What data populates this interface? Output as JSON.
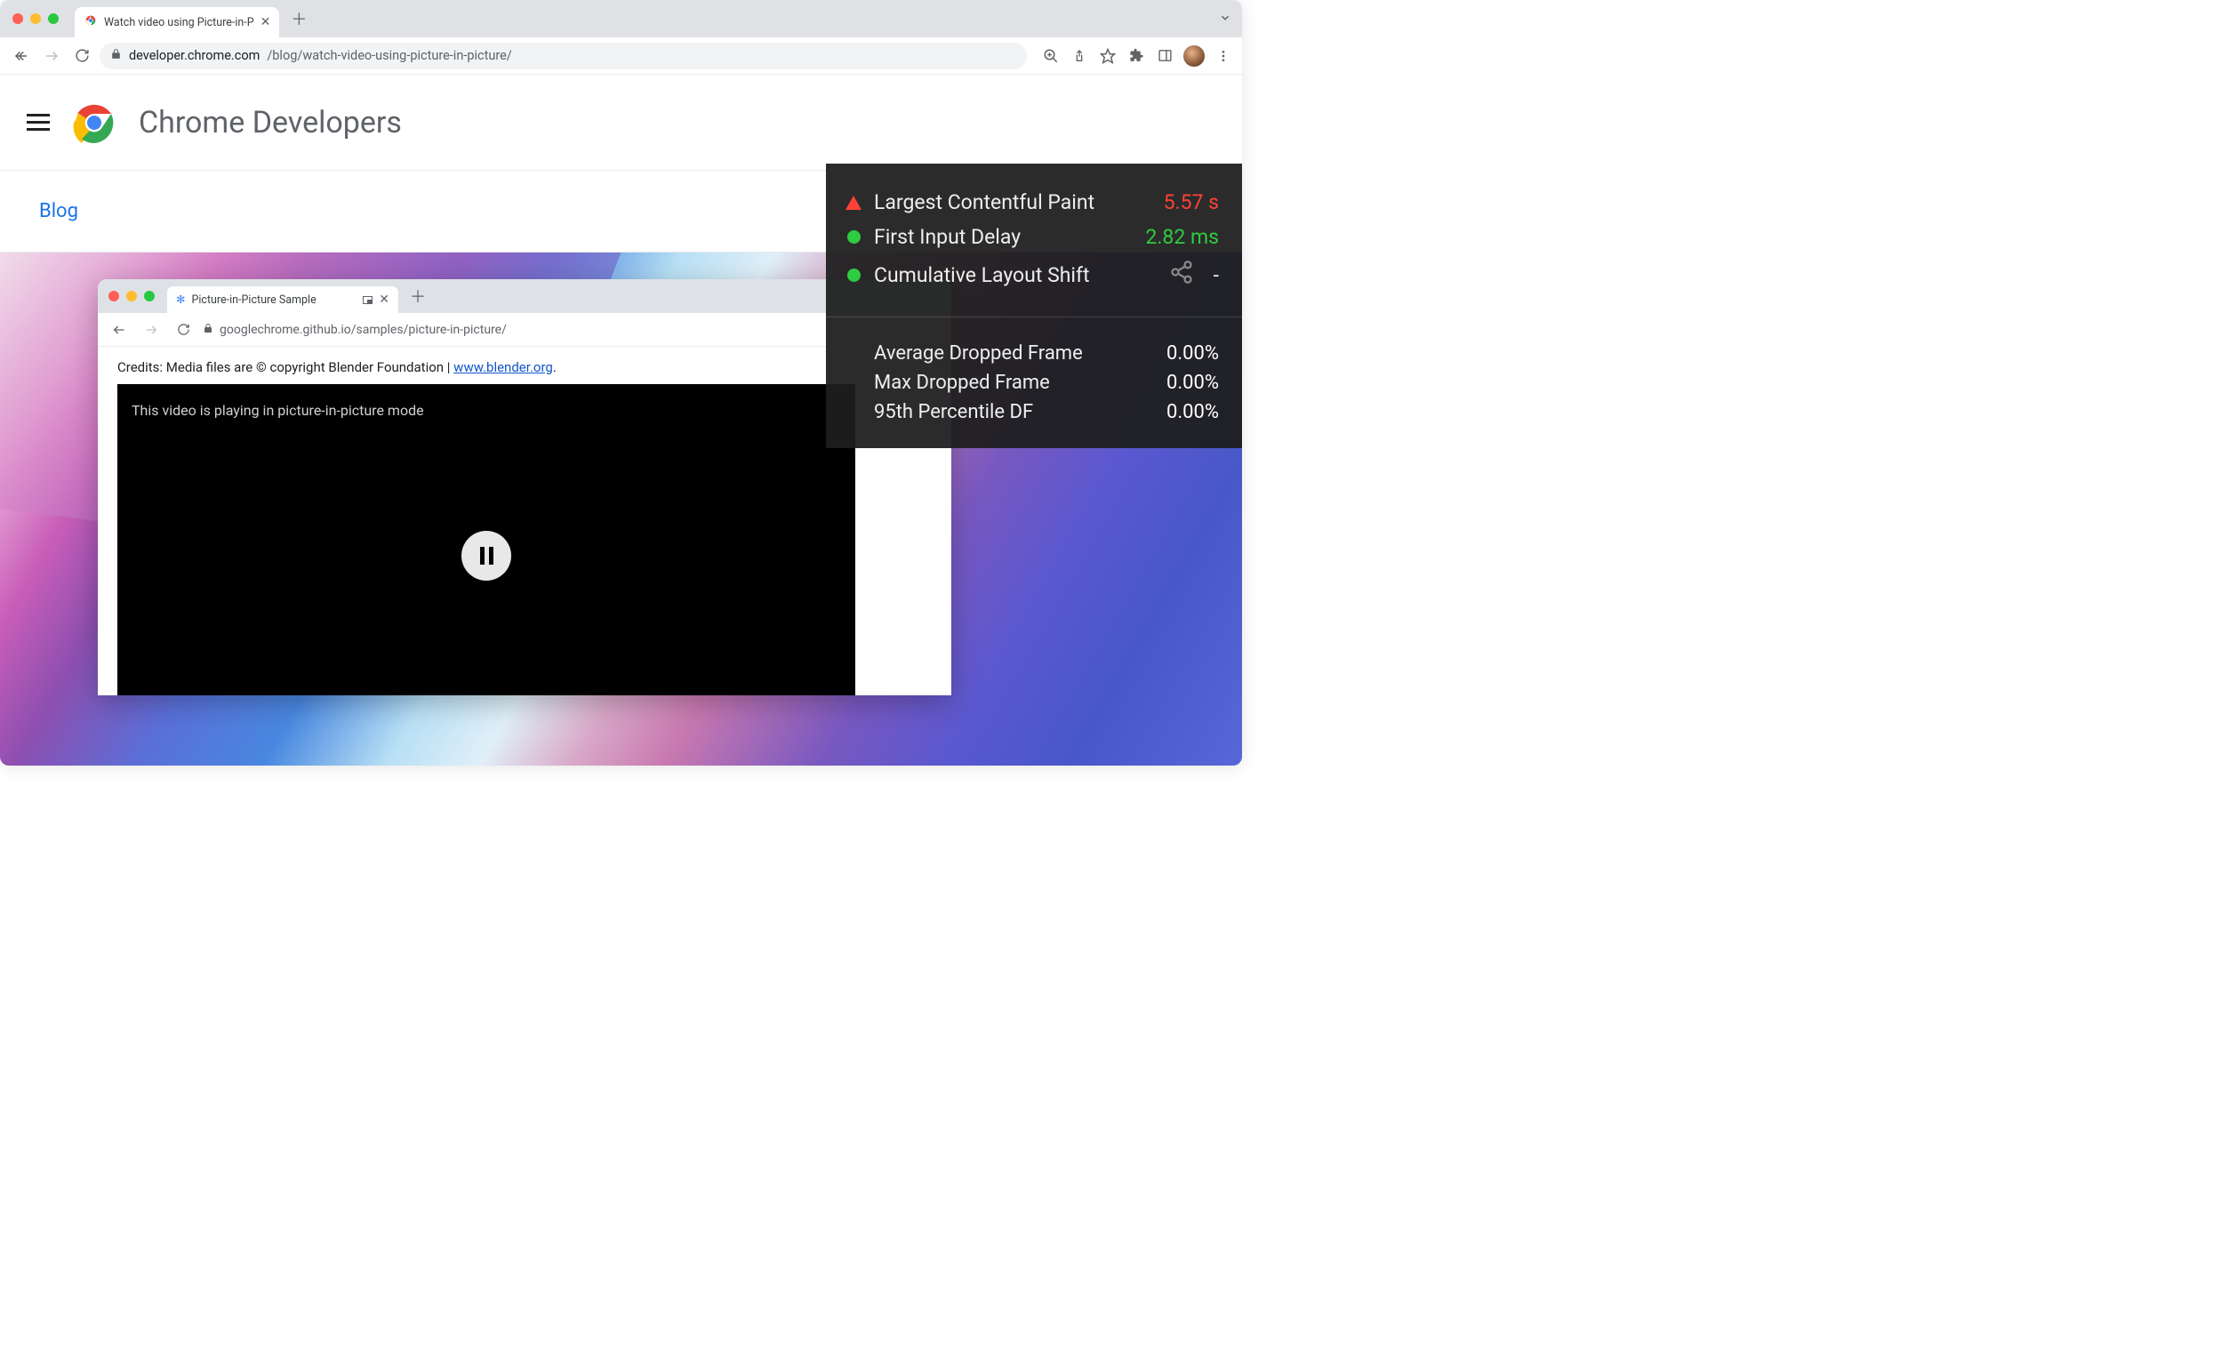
{
  "browser": {
    "tab_title": "Watch video using Picture-in-P",
    "url_host": "developer.chrome.com",
    "url_path": "/blog/watch-video-using-picture-in-picture/"
  },
  "site": {
    "title": "Chrome Developers",
    "breadcrumb": "Blog"
  },
  "nested": {
    "tab_title": "Picture-in-Picture Sample",
    "url": "googlechrome.github.io/samples/picture-in-picture/",
    "credits_prefix": "Credits: Media files are © copyright Blender Foundation | ",
    "credits_link": "www.blender.org",
    "credits_suffix": ".",
    "video_caption": "This video is playing in picture-in-picture mode"
  },
  "metrics": {
    "primary": [
      {
        "indicator": "triangle",
        "label": "Largest Contentful Paint",
        "value": "5.57 s",
        "status": "bad"
      },
      {
        "indicator": "circle",
        "label": "First Input Delay",
        "value": "2.82 ms",
        "status": "good"
      },
      {
        "indicator": "circle",
        "label": "Cumulative Layout Shift",
        "value": "-",
        "status": "neutral",
        "share": true
      }
    ],
    "secondary": [
      {
        "label": "Average Dropped Frame",
        "value": "0.00%"
      },
      {
        "label": "Max Dropped Frame",
        "value": "0.00%"
      },
      {
        "label": "95th Percentile DF",
        "value": "0.00%"
      }
    ]
  }
}
